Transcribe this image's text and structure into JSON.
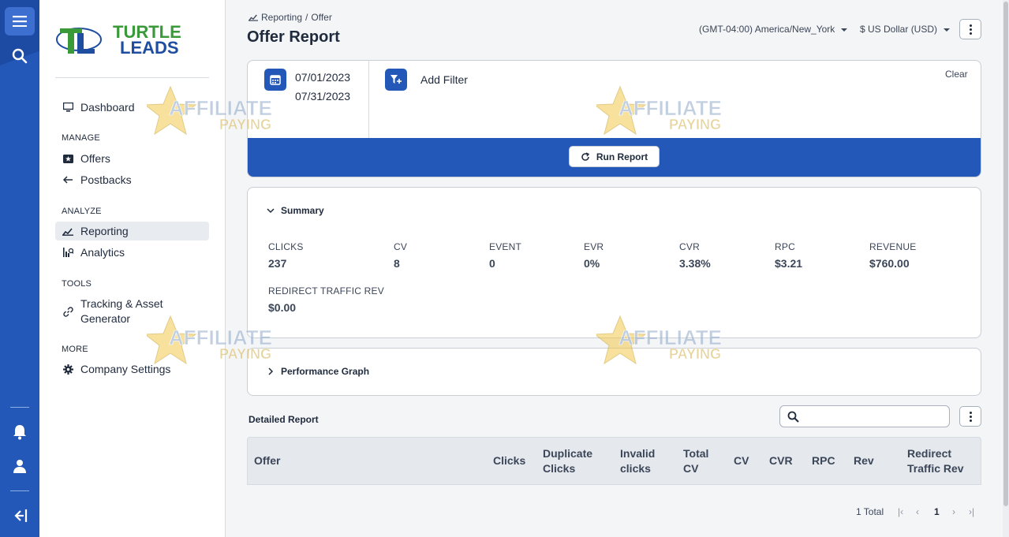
{
  "sidebar": {
    "logo_text_line1": "TURTLE",
    "logo_text_line2": "LEADS",
    "dashboard": "Dashboard",
    "group_manage": "MANAGE",
    "offers": "Offers",
    "postbacks": "Postbacks",
    "group_analyze": "ANALYZE",
    "reporting": "Reporting",
    "analytics": "Analytics",
    "group_tools": "TOOLS",
    "tracking_line1": "Tracking & Asset",
    "tracking_line2": "Generator",
    "group_more": "MORE",
    "company_settings": "Company Settings"
  },
  "watermark": {
    "line1": "AFFILIATE",
    "line2": "PAYING"
  },
  "header": {
    "breadcrumb_parent": "Reporting",
    "breadcrumb_sep": "/",
    "breadcrumb_current": "Offer",
    "title": "Offer Report",
    "timezone": "(GMT-04:00) America/New_York",
    "currency": "$ US Dollar (USD)"
  },
  "filter": {
    "start_date": "07/01/2023",
    "end_date": "07/31/2023",
    "add_filter": "Add Filter",
    "clear": "Clear",
    "run_report": "Run Report"
  },
  "summary": {
    "heading": "Summary",
    "metrics": [
      {
        "label": "CLICKS",
        "value": "237"
      },
      {
        "label": "CV",
        "value": "8"
      },
      {
        "label": "EVENT",
        "value": "0"
      },
      {
        "label": "EVR",
        "value": "0%"
      },
      {
        "label": "CVR",
        "value": "3.38%"
      },
      {
        "label": "RPC",
        "value": "$3.21"
      },
      {
        "label": "REVENUE",
        "value": "$760.00"
      },
      {
        "label": "REDIRECT TRAFFIC REV",
        "value": "$0.00"
      }
    ]
  },
  "graph": {
    "heading": "Performance Graph"
  },
  "detail": {
    "title": "Detailed Report",
    "search_placeholder": "",
    "columns": [
      {
        "l1": "Offer",
        "l2": ""
      },
      {
        "l1": "Clicks",
        "l2": ""
      },
      {
        "l1": "Duplicate",
        "l2": "Clicks"
      },
      {
        "l1": "Invalid",
        "l2": "clicks"
      },
      {
        "l1": "Total",
        "l2": "CV"
      },
      {
        "l1": "CV",
        "l2": ""
      },
      {
        "l1": "CVR",
        "l2": ""
      },
      {
        "l1": "RPC",
        "l2": ""
      },
      {
        "l1": "Rev",
        "l2": ""
      },
      {
        "l1": "Redirect",
        "l2": "Traffic Rev"
      }
    ]
  },
  "pagination": {
    "total": "1 Total",
    "current_page": "1",
    "first": "|‹",
    "prev": "‹",
    "next": "›",
    "last": "›|"
  },
  "colors": {
    "brand_blue": "#2458b8",
    "logo_green": "#3a9a3a",
    "logo_blue": "#1f4ea0"
  }
}
